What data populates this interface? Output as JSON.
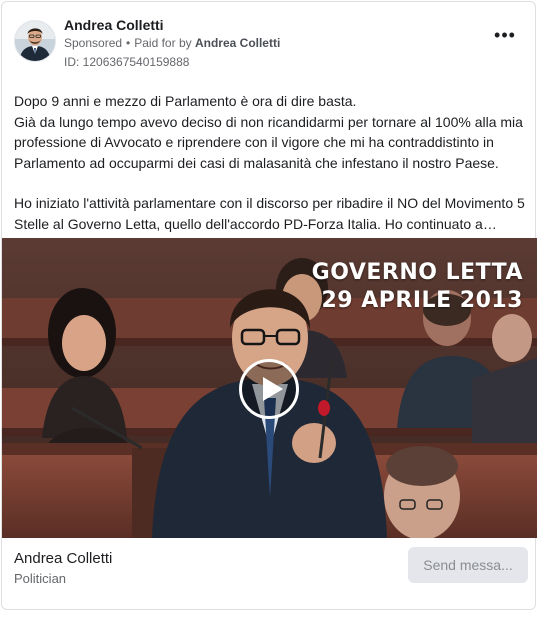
{
  "ad": {
    "advertiser_name": "Andrea Colletti",
    "sponsored_label": "Sponsored",
    "separator": "•",
    "paid_for_prefix": "Paid for by",
    "payer_name": "Andrea Colletti",
    "ad_id": "ID: 1206367540159888",
    "more_icon": "more-horizontal-icon",
    "more_label": "•••"
  },
  "body": {
    "paragraph_1_line_1": "Dopo 9 anni e mezzo di Parlamento è ora di dire basta.",
    "paragraph_1_rest": "Già da lungo tempo avevo deciso di non ricandidarmi per tornare al 100% alla mia professione di Avvocato e riprendere con il vigore che mi ha contraddistinto in Parlamento ad occuparmi dei casi di malasanità che infestano il nostro Paese.",
    "paragraph_2": "Ho iniziato l'attività parlamentare con il discorso per ribadire il NO del Movimento 5 Stelle al Governo Letta, quello dell'accordo PD-Forza Italia. Ho continuato a…"
  },
  "video": {
    "overlay_line_1": "GOVERNO LETTA",
    "overlay_line_2": "29 APRILE 2013",
    "play_icon": "play-icon"
  },
  "footer": {
    "page_name": "Andrea Colletti",
    "page_category": "Politician",
    "cta_label": "Send messa..."
  },
  "colors": {
    "text_primary": "#1c1e21",
    "text_secondary": "#65676b",
    "cta_background": "#e4e6eb",
    "cta_text": "#8a8d91"
  }
}
